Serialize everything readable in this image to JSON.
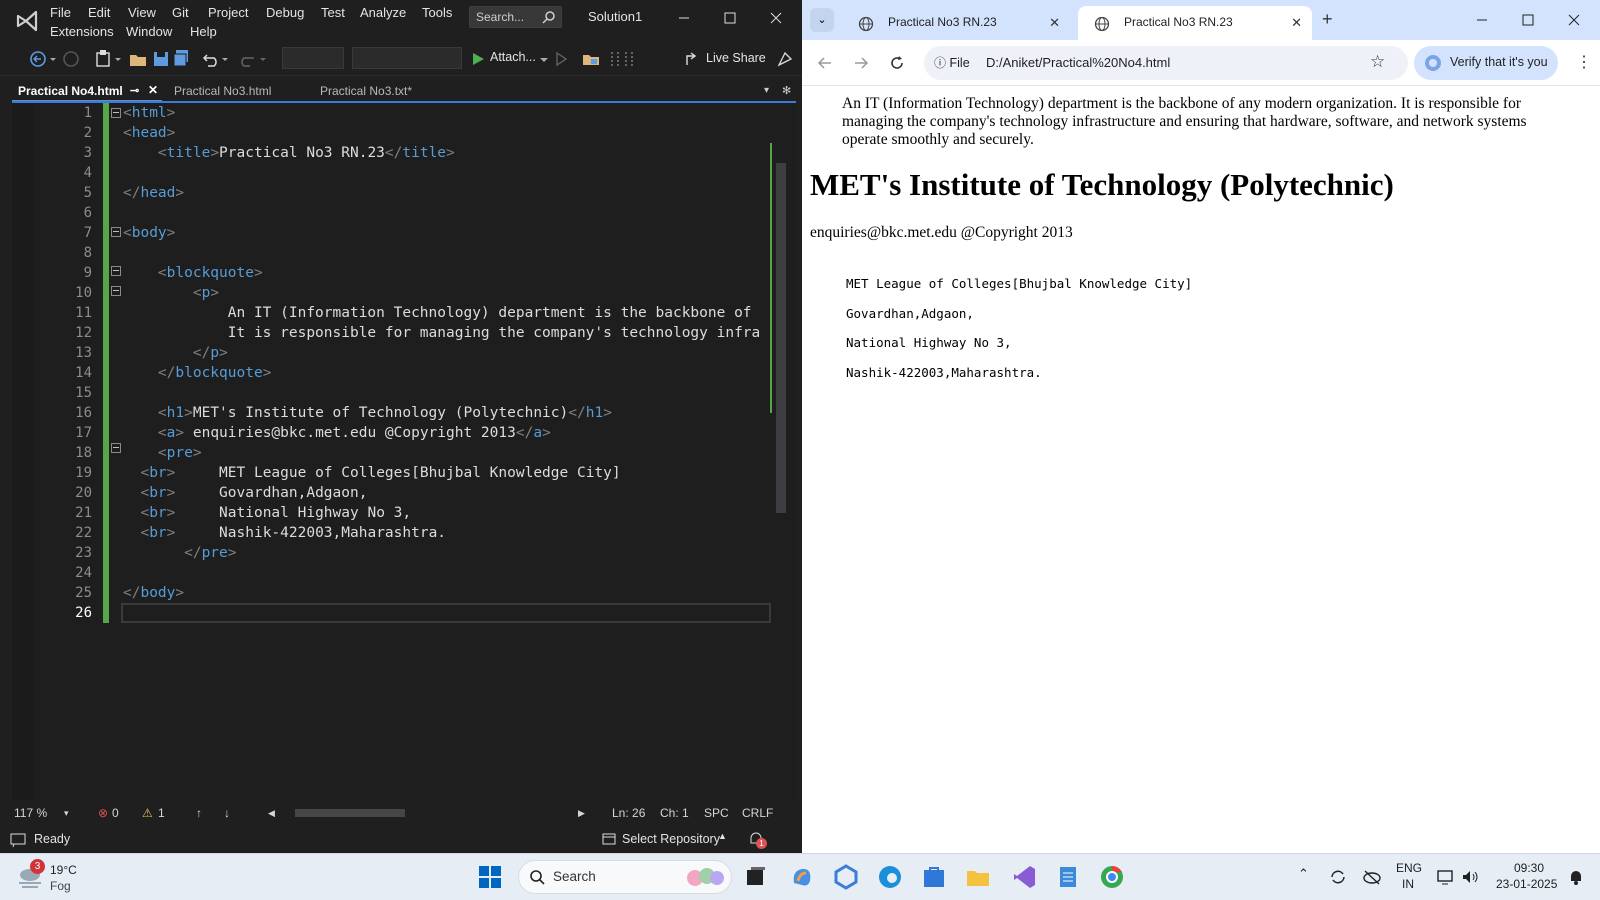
{
  "vs": {
    "menu": [
      "File",
      "Edit",
      "View",
      "Git",
      "Project",
      "Debug",
      "Test",
      "Analyze",
      "Tools",
      "Extensions",
      "Window",
      "Help"
    ],
    "search_placeholder": "Search...",
    "solution": "Solution1",
    "attach": "Attach...",
    "live_share": "Live Share",
    "tabs": [
      "Practical No4.html",
      "Practical No3.html",
      "Practical No3.txt*"
    ],
    "line_numbers": [
      "1",
      "2",
      "3",
      "4",
      "5",
      "6",
      "7",
      "8",
      "9",
      "10",
      "11",
      "12",
      "13",
      "14",
      "15",
      "16",
      "17",
      "18",
      "19",
      "20",
      "21",
      "22",
      "23",
      "24",
      "25",
      "26"
    ],
    "code": [
      "<html>",
      "<head>",
      "    <title>Practical No3 RN.23</title>",
      "",
      "</head>",
      "",
      "<body>",
      "",
      "    <blockquote>",
      "        <p>",
      "            An IT (Information Technology) department is the backbone of",
      "            It is responsible for managing the company's technology infra",
      "        </p>",
      "    </blockquote>",
      "",
      "    <h1>MET's Institute of Technology (Polytechnic)</h1>",
      "    <a> enquiries@bkc.met.edu @Copyright 2013</a>",
      "    <pre>",
      "  <br>     MET League of Colleges[Bhujbal Knowledge City]",
      "  <br>     Govardhan,Adgaon,",
      "  <br>     National Highway No 3,",
      "  <br>     Nashik-422003,Maharashtra.",
      "       </pre>",
      "",
      "</body>",
      ""
    ],
    "status": {
      "zoom": "117 %",
      "errors": "0",
      "warnings": "1",
      "ln": "Ln: 26",
      "ch": "Ch: 1",
      "spc": "SPC",
      "eol": "CRLF",
      "ready": "Ready",
      "select_repo": "Select Repository",
      "notif_count": "1"
    }
  },
  "browser": {
    "tabs": [
      "Practical No3 RN.23",
      "Practical No3 RN.23"
    ],
    "file_chip": "File",
    "url": "D:/Aniket/Practical%20No4.html",
    "verify": "Verify that it's you",
    "page": {
      "blockquote": "An IT (Information Technology) department is the backbone of any modern organization. It is responsible for managing the company's technology infrastructure and ensuring that hardware, software, and network systems operate smoothly and securely.",
      "h1": "MET's Institute of Technology (Polytechnic)",
      "link": "enquiries@bkc.met.edu @Copyright 2013",
      "pre": [
        "MET League of Colleges[Bhujbal Knowledge City]",
        "Govardhan,Adgaon,",
        "National Highway No 3,",
        "Nashik-422003,Maharashtra."
      ]
    }
  },
  "taskbar": {
    "weather_temp": "19°C",
    "weather_desc": "Fog",
    "weather_badge": "3",
    "search": "Search",
    "lang": "ENG",
    "region": "IN",
    "time": "09:30",
    "date": "23-01-2025"
  },
  "colors": {
    "vs_bg": "#1f1f1f",
    "tag_blue": "#569cd6",
    "change_green": "#57a64a",
    "browser_tabbar": "#d3e3fd"
  }
}
